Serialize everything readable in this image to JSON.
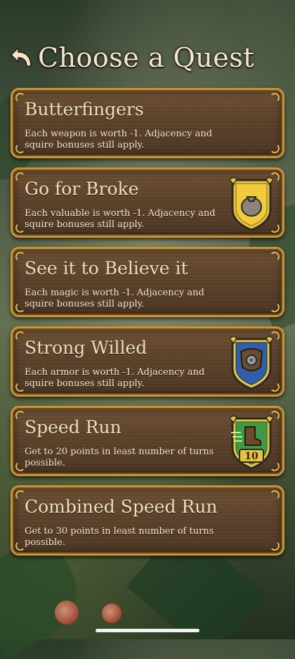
{
  "header": {
    "title": "Choose a Quest"
  },
  "quests": [
    {
      "title": "Butterfingers",
      "description": "Each weapon is worth -1. Adjacency and squire bonuses still apply.",
      "badge": null
    },
    {
      "title": "Go for Broke",
      "description": "Each valuable is worth -1. Adjacency and squire bonuses still apply.",
      "badge": "money-bag-shield-icon"
    },
    {
      "title": "See it to Believe it",
      "description": "Each magic is worth -1. Adjacency and squire bonuses still apply.",
      "badge": null
    },
    {
      "title": "Strong Willed",
      "description": "Each armor is worth -1. Adjacency and squire bonuses still apply.",
      "badge": "armor-shield-icon"
    },
    {
      "title": "Speed Run",
      "description": "Get to 20 points in least number of turns possible.",
      "badge": "speed-boot-shield-icon",
      "badge_text": "10"
    },
    {
      "title": "Combined Speed Run",
      "description": "Get to 30 points in least number of turns possible.",
      "badge": null
    }
  ],
  "colors": {
    "card_border": "#c99536",
    "card_fill": "#5a4029",
    "text": "#f0dfbb"
  }
}
